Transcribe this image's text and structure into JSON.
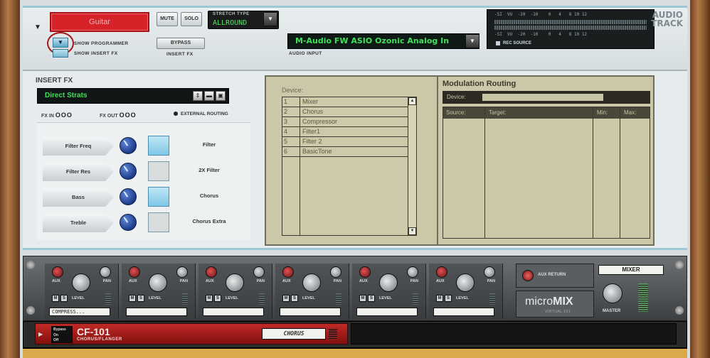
{
  "track": {
    "name": "Guitar",
    "mute_label": "MUTE",
    "solo_label": "SOLO",
    "stretch_label": "STRETCH TYPE",
    "stretch_value": "ALLROUND",
    "show_programmer_label": "SHOW PROGRAMMER",
    "show_insert_fx_label": "SHOW INSERT FX",
    "bypass_label": "BYPASS",
    "insert_fx_small_label": "INSERT FX",
    "audio_input_value": "M-Audio FW ASIO Ozonic Analog In",
    "audio_input_label": "AUDIO INPUT",
    "vu_scale": "-SI  VU  -20  -10    0   4   8 10 12",
    "rec_source_label": "REC SOURCE",
    "track_type_line1": "AUDIO",
    "track_type_line2": "TRACK"
  },
  "insert_fx": {
    "title": "INSERT FX",
    "patch_name": "Direct Strats",
    "fx_in_label": "FX IN",
    "fx_out_label": "FX OUT",
    "leds": "OOO",
    "external_routing_label": "EXTERNAL ROUTING",
    "macros": [
      {
        "knob_label": "Filter Freq",
        "button_label": "Filter",
        "button_on": true
      },
      {
        "knob_label": "Filter Res",
        "button_label": "2X Filter",
        "button_on": false
      },
      {
        "knob_label": "Bass",
        "button_label": "Chorus",
        "button_on": true
      },
      {
        "knob_label": "Treble",
        "button_label": "Chorus Extra",
        "button_on": false
      }
    ]
  },
  "routing": {
    "device_label": "Device:",
    "devices": [
      {
        "num": "1",
        "name": "Mixer"
      },
      {
        "num": "2",
        "name": "Chorus"
      },
      {
        "num": "3",
        "name": "Compressor"
      },
      {
        "num": "4",
        "name": "Filter1"
      },
      {
        "num": "5",
        "name": "Filter 2"
      },
      {
        "num": "6",
        "name": "BasicTone"
      }
    ],
    "modulation_title": "Modulation Routing",
    "mod_device_label": "Device:",
    "columns": {
      "source": "Source:",
      "target": "Target:",
      "min": "Min:",
      "max": "Max:"
    }
  },
  "mixer": {
    "channels": [
      {
        "aux": "AUX",
        "pan": "PAN",
        "level": "LEVEL",
        "mute": "M",
        "solo": "S",
        "name": "COMPRESS..."
      },
      {
        "aux": "AUX",
        "pan": "PAN",
        "level": "LEVEL",
        "mute": "M",
        "solo": "S",
        "name": ""
      },
      {
        "aux": "AUX",
        "pan": "PAN",
        "level": "LEVEL",
        "mute": "M",
        "solo": "S",
        "name": ""
      },
      {
        "aux": "AUX",
        "pan": "PAN",
        "level": "LEVEL",
        "mute": "M",
        "solo": "S",
        "name": ""
      },
      {
        "aux": "AUX",
        "pan": "PAN",
        "level": "LEVEL",
        "mute": "M",
        "solo": "S",
        "name": ""
      },
      {
        "aux": "AUX",
        "pan": "PAN",
        "level": "LEVEL",
        "mute": "M",
        "solo": "S",
        "name": ""
      }
    ],
    "aux_return_label": "AUX RETURN",
    "micromix_text": "micro",
    "micromix_bold": "MIX",
    "micromix_sub": "VIRTUAL 101",
    "mixer_label": "MIXER",
    "master_label": "MASTER"
  },
  "cf101": {
    "bypass": "Bypass",
    "on": "On",
    "off": "Off",
    "name": "CF-101",
    "sub": "CHORUS/FLANGER",
    "patch": "CHORUS"
  },
  "colors": {
    "track_red": "#d8222a",
    "lcd_green": "#3fe05a",
    "routing_bg": "#cbc7a8"
  }
}
